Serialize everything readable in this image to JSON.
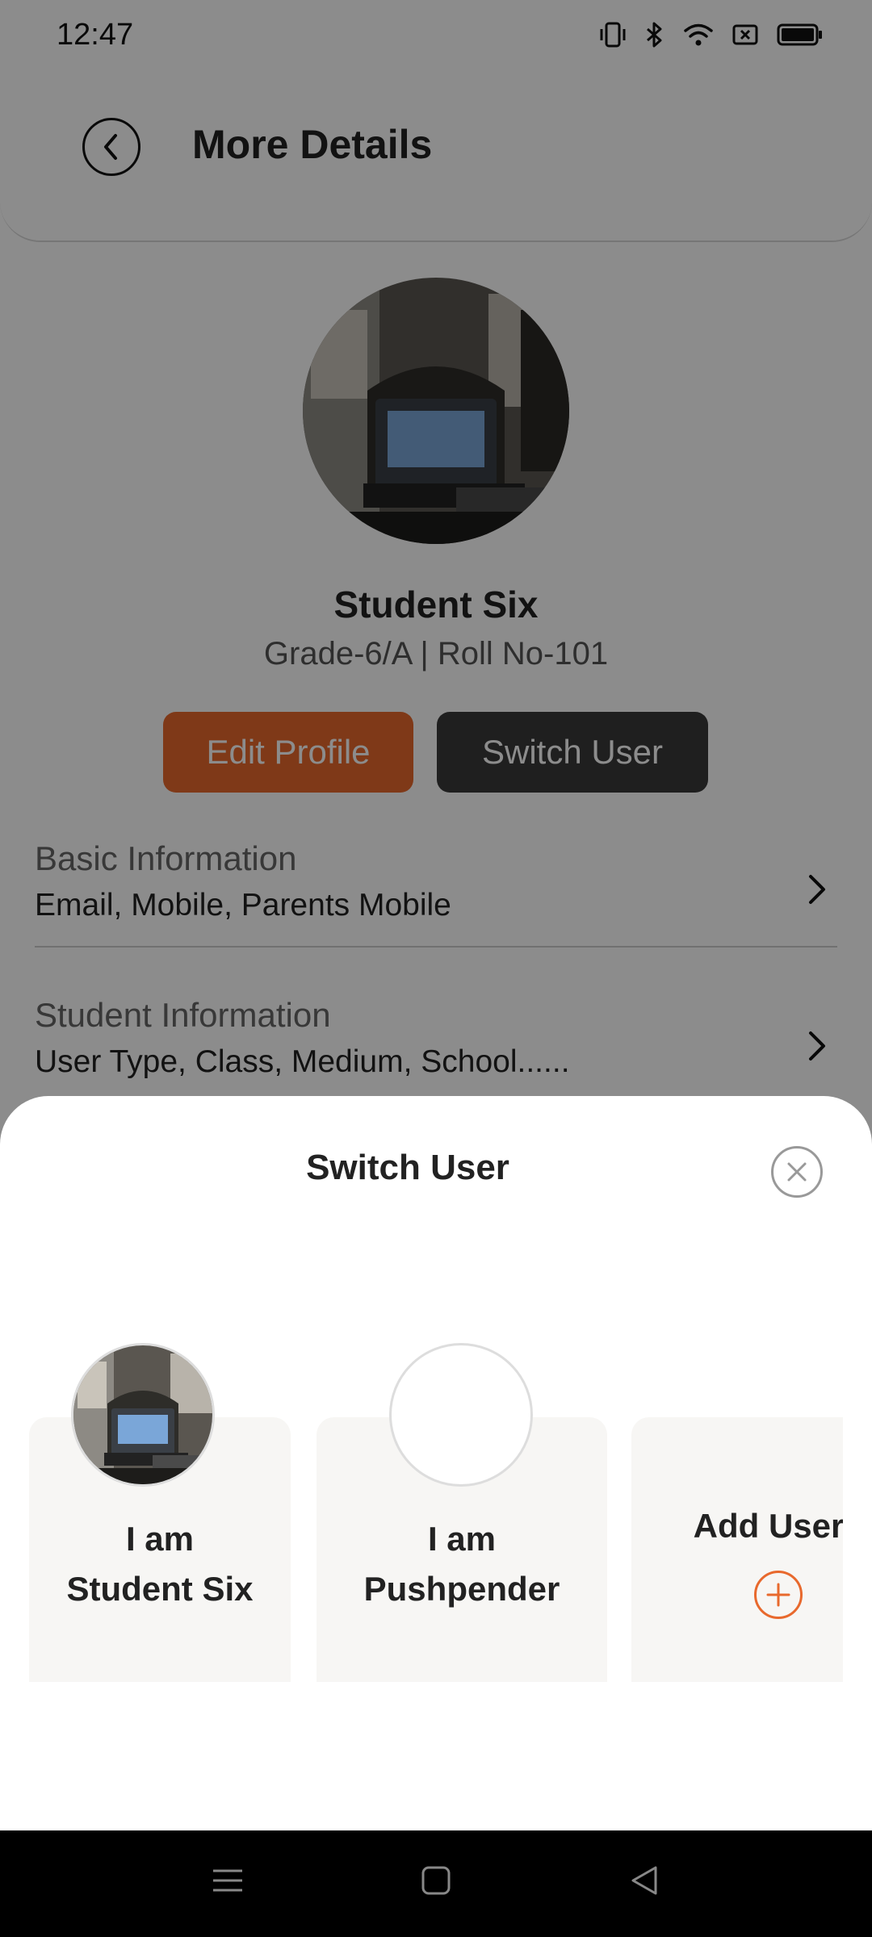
{
  "status_bar": {
    "time": "12:47",
    "icons": [
      "vibrate-icon",
      "bluetooth-icon",
      "wifi-icon",
      "sim-off-icon",
      "battery-icon"
    ]
  },
  "header": {
    "title": "More Details",
    "back_icon": "chevron-left-icon"
  },
  "profile": {
    "name": "Student Six",
    "subtitle": "Grade-6/A | Roll No-101",
    "edit_label": "Edit Profile",
    "switch_label": "Switch User"
  },
  "sections": [
    {
      "title": "Basic Information",
      "subtitle": "Email, Mobile, Parents Mobile"
    },
    {
      "title": "Student Information",
      "subtitle": "User Type, Class, Medium, School......"
    }
  ],
  "sheet": {
    "title": "Switch User",
    "close_icon": "close-icon",
    "users": [
      {
        "line1": "I am",
        "line2": "Student Six",
        "has_photo": true
      },
      {
        "line1": "I am",
        "line2": "Pushpender",
        "has_photo": false
      }
    ],
    "add_user_label": "Add User"
  },
  "colors": {
    "accent": "#e8692d",
    "dark_button": "#3a3a3a",
    "card_bg": "#f7f6f4"
  },
  "nav_bar": {
    "icons": [
      "menu-icon",
      "home-icon",
      "back-icon"
    ]
  }
}
